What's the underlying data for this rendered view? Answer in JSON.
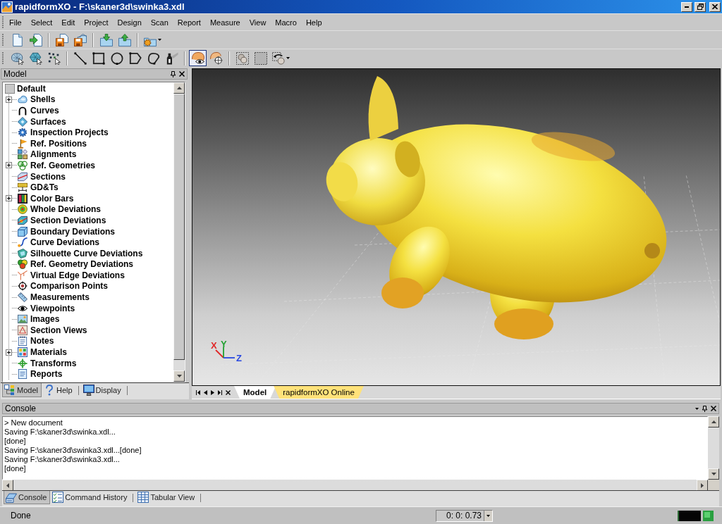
{
  "window": {
    "title": "rapidformXO - F:\\skaner3d\\swinka3.xdl"
  },
  "menu": [
    "File",
    "Select",
    "Edit",
    "Project",
    "Design",
    "Scan",
    "Report",
    "Measure",
    "View",
    "Macro",
    "Help"
  ],
  "second_toolbar": {
    "buttons": [
      {
        "selected": false
      },
      {
        "selected": false
      },
      {
        "selected": false
      },
      {
        "selected": false
      },
      {
        "selected": false
      },
      {
        "selected": false
      },
      {
        "selected": false
      },
      {
        "selected": false
      },
      {
        "selected": false
      },
      {
        "selected": true
      },
      {
        "selected": false
      },
      {
        "selected": false
      },
      {
        "selected": false
      },
      {
        "selected": false
      }
    ]
  },
  "model_panel": {
    "title": "Model",
    "tree": {
      "label": "Default",
      "children": [
        {
          "label": "Shells",
          "expandable": true
        },
        {
          "label": "Curves",
          "expandable": false
        },
        {
          "label": "Surfaces",
          "expandable": false
        },
        {
          "label": "Inspection Projects",
          "expandable": false
        },
        {
          "label": "Ref. Positions",
          "expandable": false
        },
        {
          "label": "Alignments",
          "expandable": false
        },
        {
          "label": "Ref. Geometries",
          "expandable": true
        },
        {
          "label": "Sections",
          "expandable": false
        },
        {
          "label": "GD&Ts",
          "expandable": false
        },
        {
          "label": "Color Bars",
          "expandable": true
        },
        {
          "label": "Whole Deviations",
          "expandable": false
        },
        {
          "label": "Section Deviations",
          "expandable": false
        },
        {
          "label": "Boundary Deviations",
          "expandable": false
        },
        {
          "label": "Curve Deviations",
          "expandable": false
        },
        {
          "label": "Silhouette Curve Deviations",
          "expandable": false
        },
        {
          "label": "Ref. Geometry Deviations",
          "expandable": false
        },
        {
          "label": "Virtual Edge Deviations",
          "expandable": false
        },
        {
          "label": "Comparison Points",
          "expandable": false
        },
        {
          "label": "Measurements",
          "expandable": false
        },
        {
          "label": "Viewpoints",
          "expandable": false
        },
        {
          "label": "Images",
          "expandable": false
        },
        {
          "label": "Section Views",
          "expandable": false
        },
        {
          "label": "Notes",
          "expandable": false
        },
        {
          "label": "Materials",
          "expandable": true
        },
        {
          "label": "Transforms",
          "expandable": false
        },
        {
          "label": "Reports",
          "expandable": false
        }
      ]
    },
    "tabs": [
      {
        "label": "Model",
        "selected": true
      },
      {
        "label": "Help",
        "selected": false
      },
      {
        "label": "Display",
        "selected": false
      }
    ]
  },
  "viewport": {
    "axes": [
      {
        "label": "X",
        "color": "#e02828"
      },
      {
        "label": "Y",
        "color": "#20a030"
      },
      {
        "label": "Z",
        "color": "#2848e0"
      }
    ],
    "tabs": [
      {
        "label": "Model",
        "selected": true,
        "color": "#ffffff"
      },
      {
        "label": "rapidformXO Online",
        "selected": false,
        "color": "#ffe27a"
      }
    ]
  },
  "console": {
    "title": "Console",
    "lines": [
      "> New document",
      "Saving F:\\skaner3d\\swinka.xdl...",
      "[done]",
      "Saving F:\\skaner3d\\swinka3.xdl...[done]",
      "Saving F:\\skaner3d\\swinka3.xdl...",
      "[done]"
    ],
    "tabs": [
      {
        "label": "Console",
        "selected": true
      },
      {
        "label": "Command History",
        "selected": false
      },
      {
        "label": "Tabular View",
        "selected": false
      }
    ]
  },
  "status_bar": {
    "message": "Done",
    "time": "0: 0: 0.73"
  }
}
